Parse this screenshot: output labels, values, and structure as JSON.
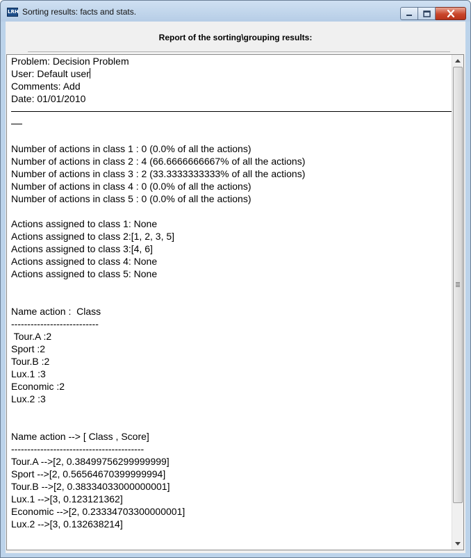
{
  "window": {
    "title": "Sorting results: facts and stats.",
    "app_icon_label": "LRH"
  },
  "header": {
    "title": "Report of the sorting\\grouping results:"
  },
  "report": {
    "meta": [
      "Problem: Decision Problem",
      "User: Default user",
      "Comments: Add",
      "Date: 01/01/2010"
    ],
    "class_counts": [
      "Number of actions in class 1 : 0 (0.0% of all the actions)",
      "Number of actions in class 2 : 4 (66.6666666667% of all the actions)",
      "Number of actions in class 3 : 2 (33.3333333333% of all the actions)",
      "Number of actions in class 4 : 0 (0.0% of all the actions)",
      "Number of actions in class 5 : 0 (0.0% of all the actions)"
    ],
    "class_assignments": [
      "Actions assigned to class 1: None",
      "Actions assigned to class 2:[1, 2, 3, 5]",
      "Actions assigned to class 3:[4, 6]",
      "Actions assigned to class 4: None",
      "Actions assigned to class 5: None"
    ],
    "name_class_header": "Name action :  Class",
    "name_class_rule": "---------------------------",
    "name_class_rows": [
      " Tour.A :2",
      "Sport :2",
      "Tour.B :2",
      "Lux.1 :3",
      "Economic :2",
      "Lux.2 :3"
    ],
    "score_header": "Name action --> [ Class , Score]",
    "score_rule": "-----------------------------------------",
    "score_rows": [
      "Tour.A -->[2, 0.38499756299999999]",
      "Sport -->[2, 0.56564670399999994]",
      "Tour.B -->[2, 0.38334033000000001]",
      "Lux.1 -->[3, 0.123121362]",
      "Economic -->[2, 0.23334703300000001]",
      "Lux.2 -->[3, 0.132638214]"
    ]
  }
}
